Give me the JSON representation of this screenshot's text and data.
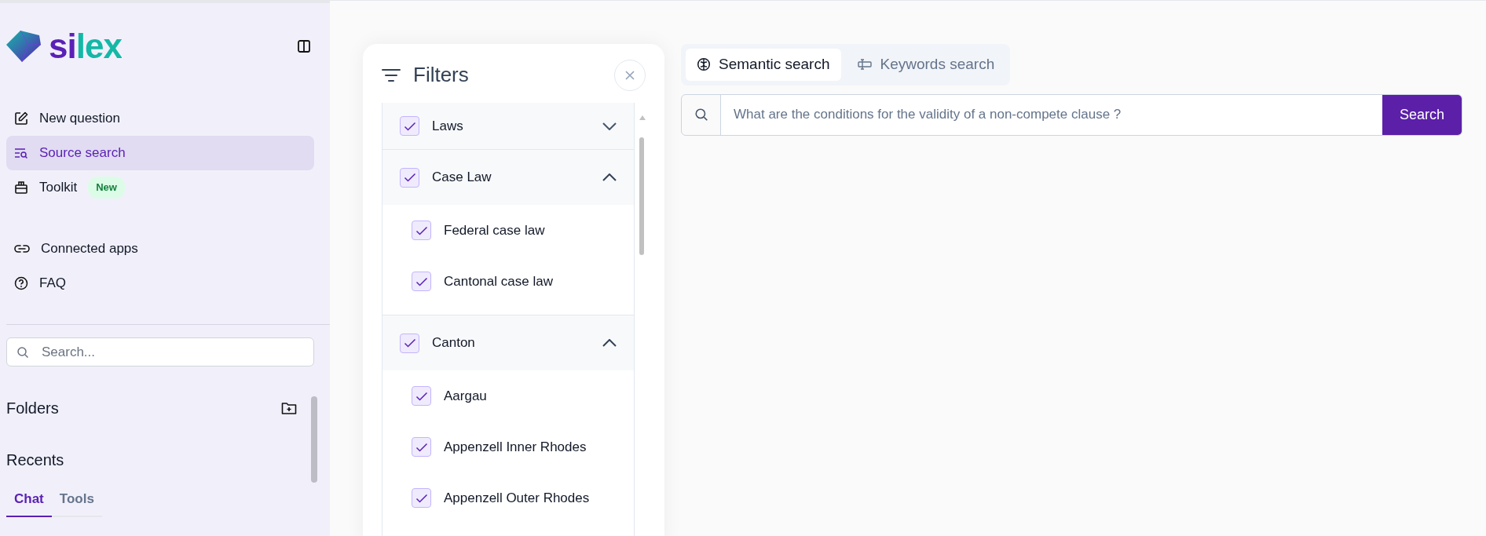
{
  "brand": {
    "name": "silex"
  },
  "nav_groups": [
    [
      {
        "label": "New question",
        "selected": false
      },
      {
        "label": "Source search",
        "selected": true
      },
      {
        "label": "Toolkit",
        "selected": false,
        "badge": "New"
      }
    ],
    [
      {
        "label": "Connected apps",
        "selected": false
      },
      {
        "label": "FAQ",
        "selected": false
      }
    ]
  ],
  "sidebar_search": {
    "placeholder": "Search..."
  },
  "folders": {
    "title": "Folders"
  },
  "recents": {
    "title": "Recents",
    "tabs": [
      {
        "label": "Chat",
        "selected": true
      },
      {
        "label": "Tools",
        "selected": false
      }
    ]
  },
  "filters": {
    "title": "Filters",
    "groups": [
      {
        "label": "Laws",
        "checked": true,
        "expanded": false
      },
      {
        "label": "Case Law",
        "checked": true,
        "expanded": true,
        "children": [
          {
            "label": "Federal case law",
            "checked": true
          },
          {
            "label": "Cantonal case law",
            "checked": true
          }
        ]
      },
      {
        "label": "Canton",
        "checked": true,
        "expanded": true,
        "children": [
          {
            "label": "Aargau",
            "checked": true
          },
          {
            "label": "Appenzell Inner Rhodes",
            "checked": true
          },
          {
            "label": "Appenzell Outer Rhodes",
            "checked": true
          }
        ]
      }
    ]
  },
  "search_modes": [
    {
      "label": "Semantic search",
      "selected": true
    },
    {
      "label": "Keywords search",
      "selected": false
    }
  ],
  "query": {
    "placeholder": "What are the conditions for the validity of a non-compete clause ?"
  },
  "search_button": "Search"
}
